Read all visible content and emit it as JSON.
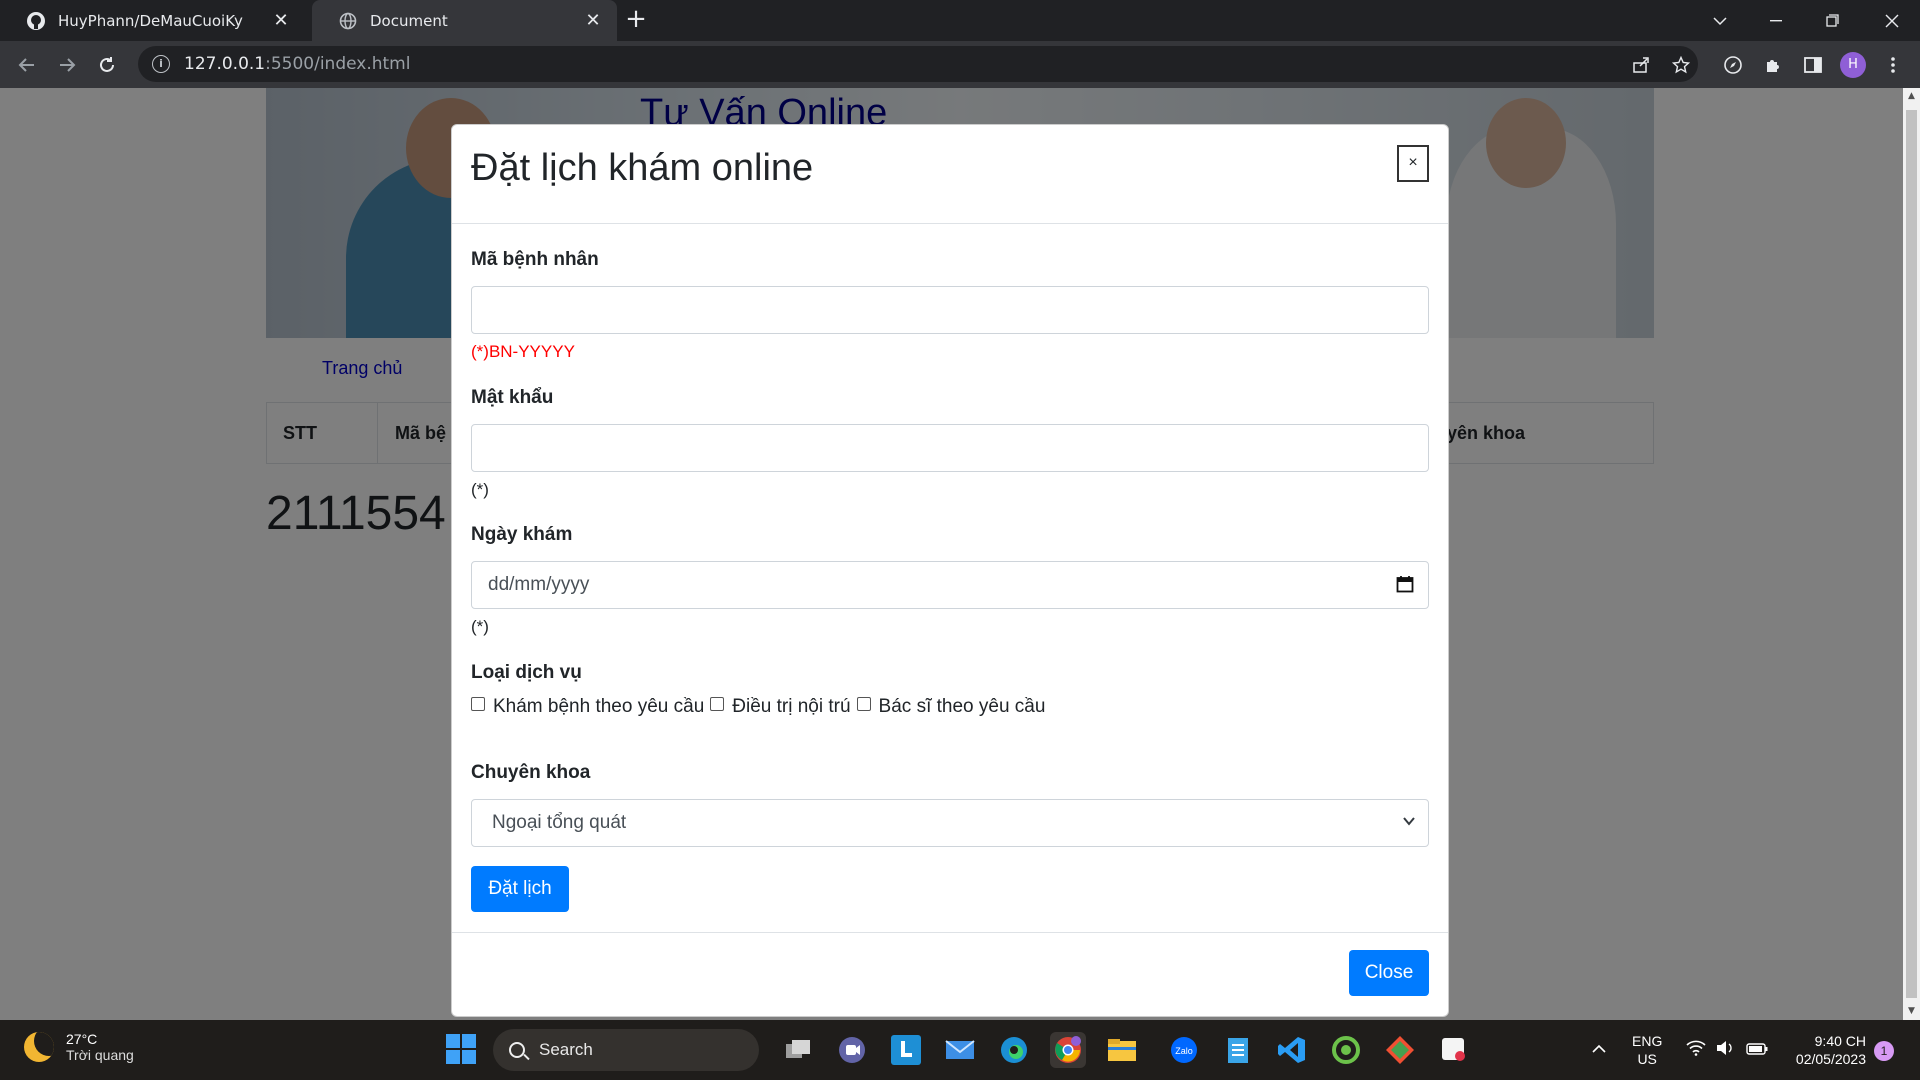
{
  "browser": {
    "tabs": [
      {
        "title": "HuyPhann/DeMauCuoiKy",
        "icon": "github-icon"
      },
      {
        "title": "Document",
        "icon": "globe-icon"
      }
    ],
    "url_host": "127.0.0.1",
    "url_rest": ":5500/index.html",
    "profile_initial": "H"
  },
  "page": {
    "hero_title": "Tư Vấn Online",
    "nav_home": "Trang chủ",
    "table_headers": [
      "STT",
      "Mã bệ",
      "yên khoa"
    ],
    "student_id": "2111554"
  },
  "modal": {
    "title": "Đặt lịch khám online",
    "close_x": "×",
    "fields": {
      "patient_id_label": "Mã bệnh nhân",
      "patient_id_value": "",
      "patient_id_hint": "(*)BN-YYYYY",
      "password_label": "Mật khẩu",
      "password_value": "",
      "password_hint": "(*)",
      "date_label": "Ngày khám",
      "date_placeholder": "dd/mm/yyyy",
      "date_hint": "(*)",
      "service_label": "Loại dịch vụ",
      "services": [
        "Khám bệnh theo yêu cầu",
        "Điều trị nội trú",
        "Bác sĩ theo yêu cầu"
      ],
      "specialty_label": "Chuyên khoa",
      "specialty_selected": "Ngoại tổng quát"
    },
    "submit_label": "Đặt lịch",
    "close_label": "Close"
  },
  "taskbar": {
    "temperature": "27°C",
    "weather": "Trời quang",
    "search_label": "Search",
    "lang_top": "ENG",
    "lang_bottom": "US",
    "time": "9:40 CH",
    "date": "02/05/2023",
    "notifications": "1"
  },
  "colors": {
    "primary": "#007bff",
    "error": "#ff0000",
    "hero_title": "#00008b",
    "chrome_dark": "#202124"
  }
}
